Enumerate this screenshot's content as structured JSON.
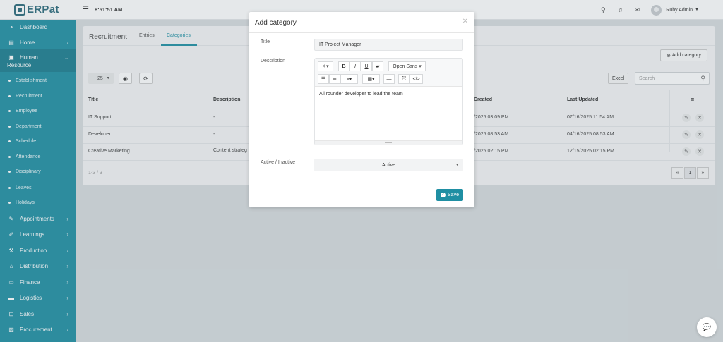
{
  "app": {
    "logo_text": "ERPat",
    "clock": "8:51:51 AM"
  },
  "user": {
    "name": "Ruby Admin"
  },
  "sidebar": {
    "dashboard": "Dashboard",
    "home": "Home",
    "human_resource_1": "Human",
    "human_resource_2": "Resource",
    "sub_items": [
      "Establishment",
      "Recruitment",
      "Employee",
      "Department",
      "Schedule",
      "Attendance",
      "Disciplinary",
      "Leaves",
      "Holidays"
    ],
    "lower_items": [
      "Appointments",
      "Learnings",
      "Production",
      "Distribution",
      "Finance",
      "Logistics",
      "Sales",
      "Procurement"
    ]
  },
  "page": {
    "title": "Recruitment",
    "tabs": [
      "Entries",
      "Categories"
    ],
    "add_button": "Add category",
    "page_size": "25",
    "excel": "Excel",
    "search_placeholder": "Search",
    "record_count": "1-3 / 3",
    "current_page": "1"
  },
  "table": {
    "headers": [
      "Title",
      "Description",
      "Created",
      "Last Updated"
    ],
    "rows": [
      {
        "title": "IT Support",
        "description": "-",
        "created": "/2025 03:09 PM",
        "updated": "07/16/2025 11:54 AM"
      },
      {
        "title": "Developer",
        "description": "-",
        "created": "/2025 08:53 AM",
        "updated": "04/16/2025 08:53 AM"
      },
      {
        "title": "Creative Marketing",
        "description": "Content strateg",
        "created": "/2025 02:15 PM",
        "updated": "12/15/2025 02:15 PM"
      }
    ]
  },
  "modal": {
    "title": "Add category",
    "title_label": "Title",
    "title_value": "IT Project Manager",
    "description_label": "Description",
    "font_name": "Open Sans",
    "description_text": "All rounder developer to lead the team",
    "status_label": "Active / Inactive",
    "status_value": "Active",
    "save_label": "Save"
  },
  "colors": {
    "accent": "#1f8fa3",
    "sidebar": "#1f8fa3"
  },
  "icons": [
    "hamburger-icon",
    "search-icon",
    "bell-icon",
    "mail-icon",
    "eye-icon",
    "refresh-icon",
    "menu-icon",
    "edit-icon",
    "close-icon",
    "chat-icon"
  ]
}
